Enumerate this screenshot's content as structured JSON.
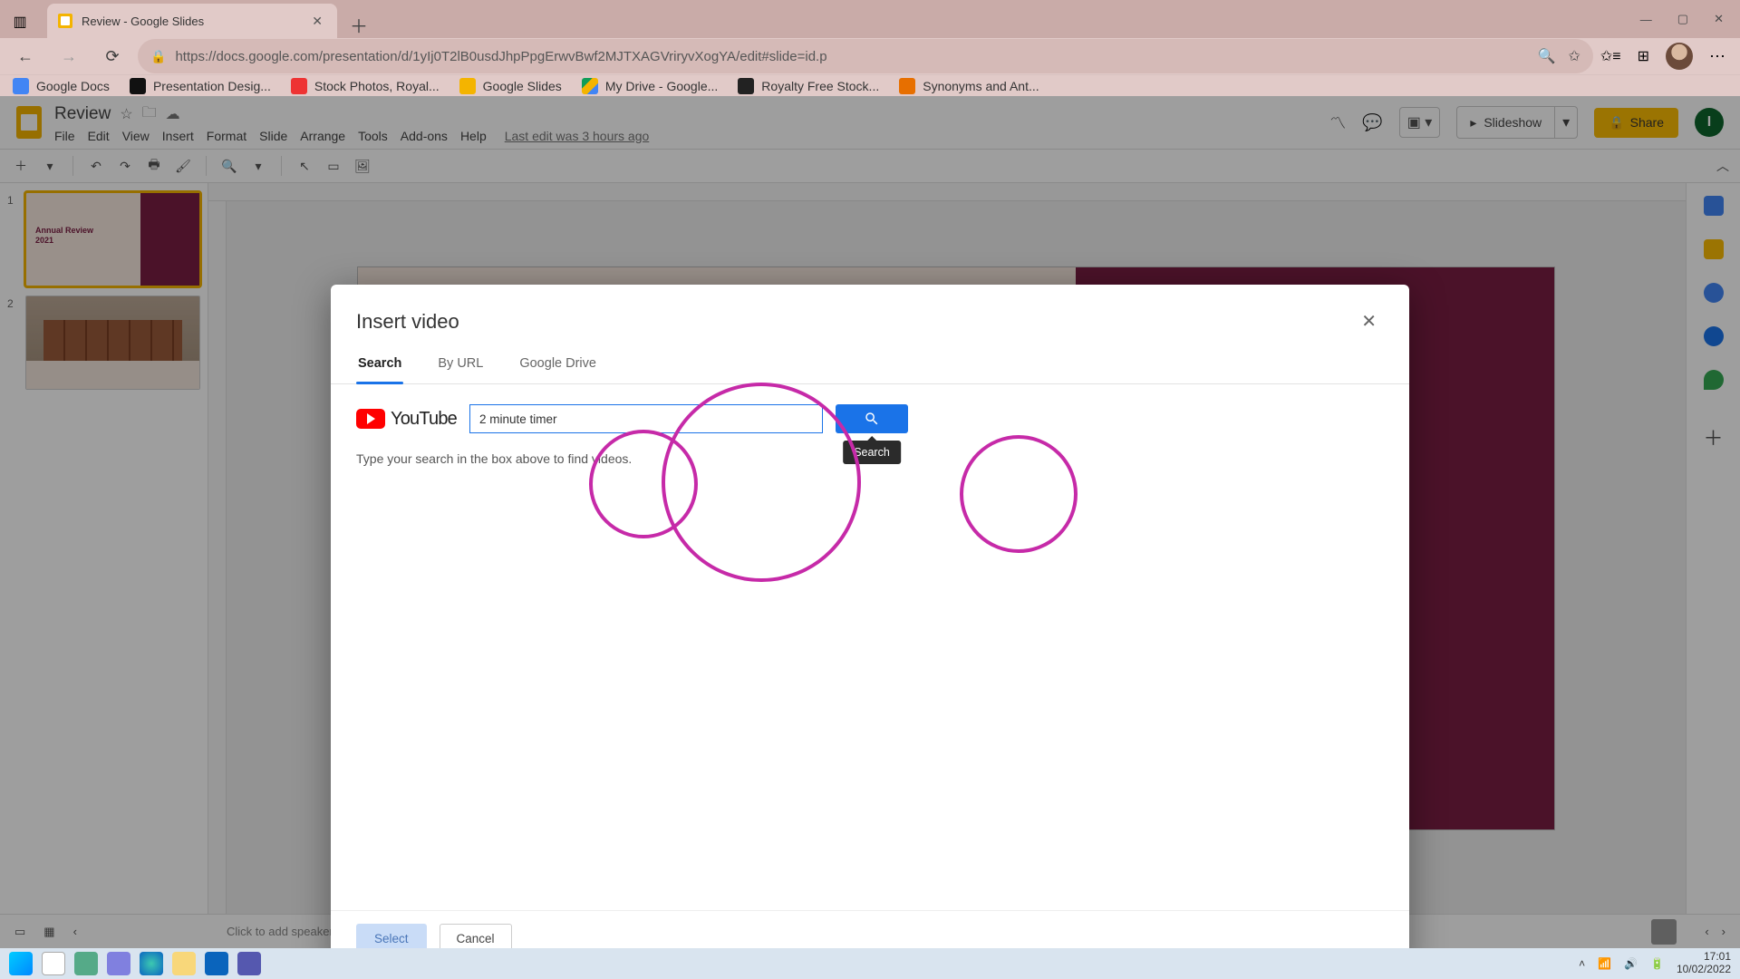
{
  "browser": {
    "tab_title": "Review - Google Slides",
    "url": "https://docs.google.com/presentation/d/1yIj0T2lB0usdJhpPpgErwvBwf2MJTXAGVriryvXogYA/edit#slide=id.p",
    "bookmarks": [
      {
        "label": "Google Docs"
      },
      {
        "label": "Presentation Desig..."
      },
      {
        "label": "Stock Photos, Royal..."
      },
      {
        "label": "Google Slides"
      },
      {
        "label": "My Drive - Google..."
      },
      {
        "label": "Royalty Free Stock..."
      },
      {
        "label": "Synonyms and Ant..."
      }
    ]
  },
  "slides": {
    "doc_title": "Review",
    "menus": [
      "File",
      "Edit",
      "View",
      "Insert",
      "Format",
      "Slide",
      "Arrange",
      "Tools",
      "Add-ons",
      "Help"
    ],
    "last_edit": "Last edit was 3 hours ago",
    "slideshow_label": "Slideshow",
    "share_label": "Share",
    "user_initial": "I",
    "thumb1_title": "Annual Review\n2021",
    "speaker_notes_placeholder": "Click to add speaker notes"
  },
  "modal": {
    "title": "Insert video",
    "tabs": {
      "search": "Search",
      "by_url": "By URL",
      "drive": "Google Drive"
    },
    "youtube_label": "YouTube",
    "search_value": "2 minute timer",
    "search_tooltip": "Search",
    "hint": "Type your search in the box above to find videos.",
    "select_label": "Select",
    "cancel_label": "Cancel"
  },
  "taskbar": {
    "time": "17:01",
    "date": "10/02/2022"
  }
}
